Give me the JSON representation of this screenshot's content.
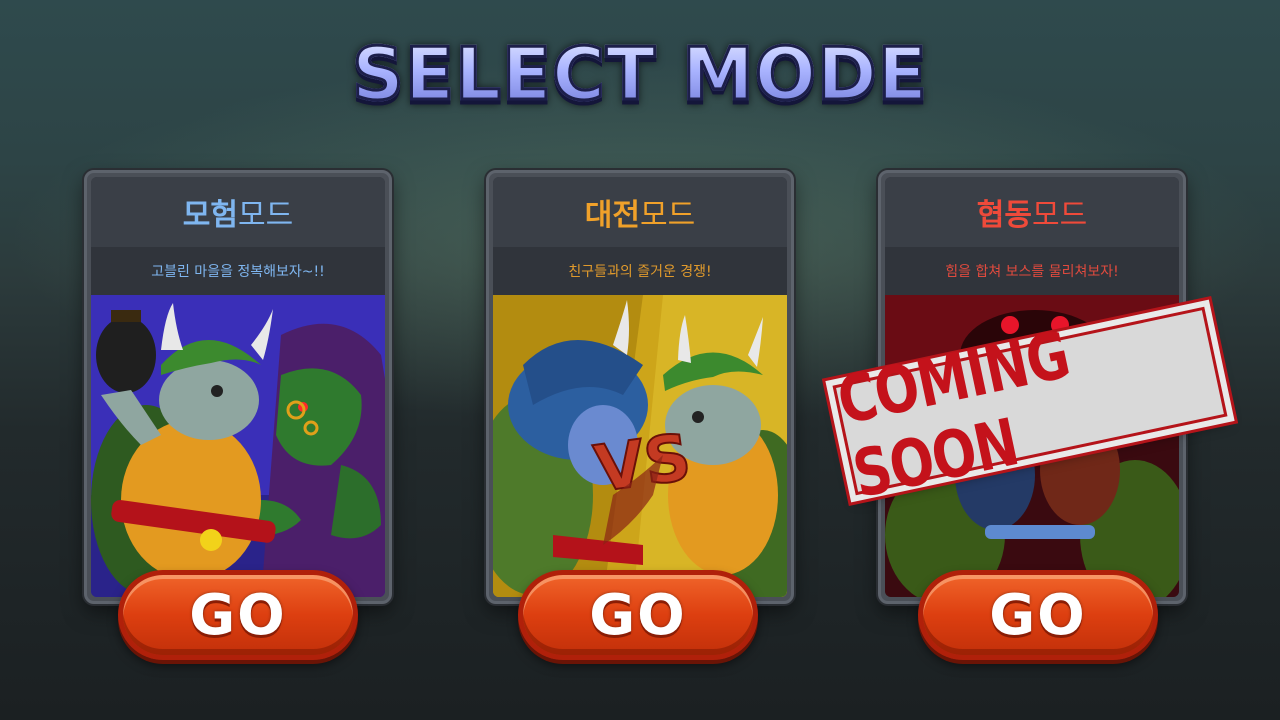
{
  "screen": {
    "title": "SELECT MODE"
  },
  "modes": [
    {
      "title_accent": "모험",
      "title_rest": "모드",
      "subtitle": "고블린 마을을 정복해보자~!!",
      "accent_color": "#7fb6f0",
      "go_label": "GO",
      "art": "turtle-vs-goblin"
    },
    {
      "title_accent": "대전",
      "title_rest": "모드",
      "subtitle": "친구들과의 즐거운 경쟁!",
      "accent_color": "#f0a12a",
      "go_label": "GO",
      "art": "turtle-vs-turtle",
      "badge": "VS"
    },
    {
      "title_accent": "협동",
      "title_rest": "모드",
      "subtitle": "힘을 합쳐 보스를 물리쳐보자!",
      "accent_color": "#ef4a3a",
      "go_label": "GO",
      "art": "turtles-vs-boss",
      "stamp": "COMING SOON"
    }
  ]
}
